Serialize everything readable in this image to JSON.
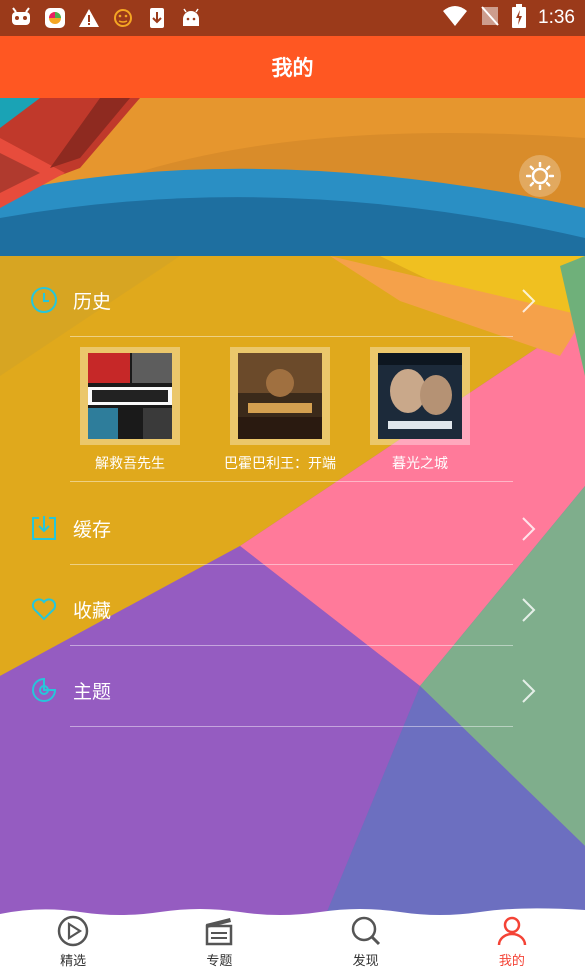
{
  "status_bar": {
    "time": "1:36",
    "left_icons": [
      "fm-radio-icon",
      "app-store-icon",
      "warning-icon",
      "face-icon",
      "download-icon",
      "android-icon"
    ],
    "right_icons": [
      "wifi-icon",
      "no-sim-icon",
      "battery-charging-icon"
    ]
  },
  "header": {
    "title": "我的"
  },
  "banner": {
    "settings_icon": "brightness-icon"
  },
  "menu": {
    "history": {
      "label": "历史",
      "icon": "clock-icon"
    },
    "history_items": [
      {
        "title": "解救吾先生"
      },
      {
        "title": "巴霍巴利王：开端"
      },
      {
        "title": "暮光之城"
      }
    ],
    "cache": {
      "label": "缓存",
      "icon": "download-box-icon"
    },
    "favorites": {
      "label": "收藏",
      "icon": "heart-icon"
    },
    "theme": {
      "label": "主题",
      "icon": "palette-icon"
    }
  },
  "bottom_nav": {
    "items": [
      {
        "label": "精选",
        "icon": "play-circle-icon",
        "active": false
      },
      {
        "label": "专题",
        "icon": "clapperboard-icon",
        "active": false
      },
      {
        "label": "发现",
        "icon": "search-icon",
        "active": false
      },
      {
        "label": "我的",
        "icon": "user-icon",
        "active": true
      }
    ]
  },
  "colors": {
    "status_bar": "#9b3a1a",
    "title_bar": "#ff5722",
    "accent_icon": "#26c6da",
    "active_nav": "#f44336"
  }
}
